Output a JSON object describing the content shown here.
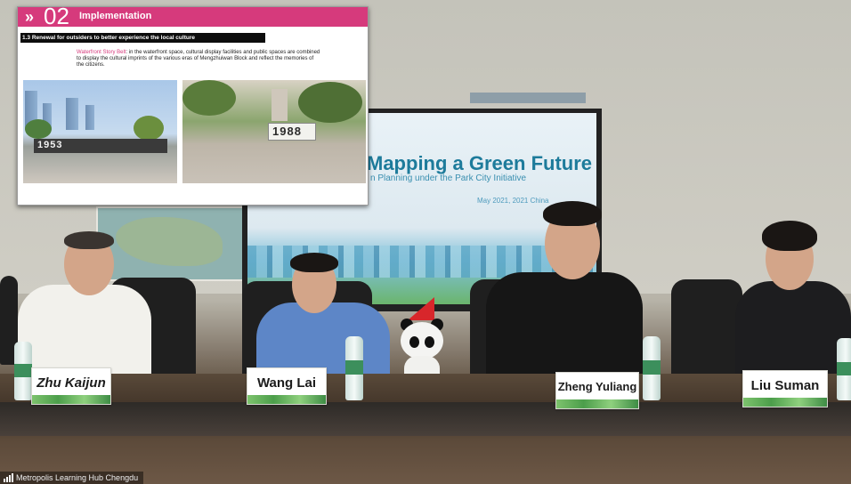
{
  "slide": {
    "number": "02",
    "title": "Implementation",
    "section": "1.3 Renewal for outsiders to better experience the local culture",
    "body_highlight": "Waterfront Story Belt",
    "body_text": ": in the waterfront space, cultural display facilities and public spaces are combined to display the cultural imprints of the various eras of Mengzhuiwan Block and reflect the memories of the citizens.",
    "photo_left_text": "1953",
    "photo_right_text": "1988",
    "accent_color": "#d63a7c"
  },
  "video": {
    "screen_title": "Mapping a Green Future",
    "screen_subtitle": "n Planning under the Park City Initiative",
    "screen_date": "May 2021, 2021 China"
  },
  "nameplates": [
    {
      "name": "Zhu Kaijun"
    },
    {
      "name": "Wang Lai"
    },
    {
      "name": "Zheng Yuliang"
    },
    {
      "name": "Liu Suman"
    }
  ],
  "meeting": {
    "label": "Metropolis Learning Hub Chengdu",
    "signal_icon": "signal-bars-icon"
  }
}
